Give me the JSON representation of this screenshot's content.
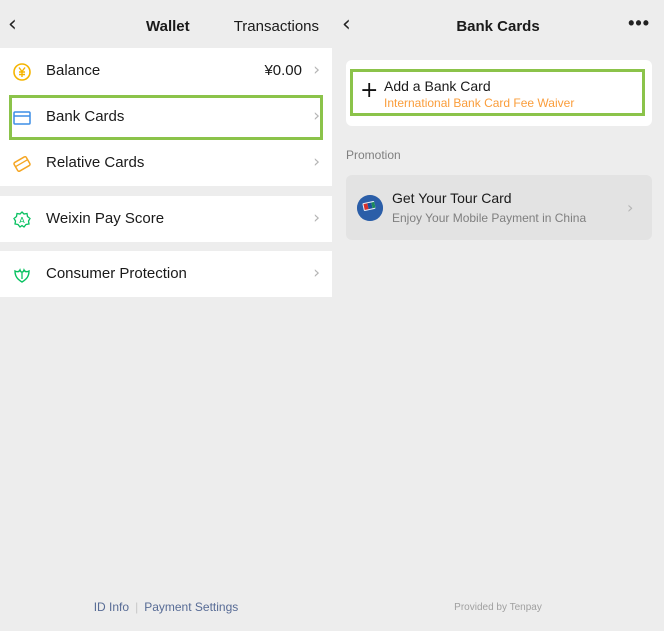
{
  "wallet": {
    "title": "Wallet",
    "transactions": "Transactions",
    "groups": [
      [
        {
          "label": "Balance",
          "value": "¥0.00",
          "icon": "yen-coin-icon"
        },
        {
          "label": "Bank Cards",
          "value": "",
          "icon": "card-icon"
        },
        {
          "label": "Relative Cards",
          "value": "",
          "icon": "relative-card-icon"
        }
      ],
      [
        {
          "label": "Weixin Pay Score",
          "value": "",
          "icon": "pay-score-icon"
        }
      ],
      [
        {
          "label": "Consumer Protection",
          "value": "",
          "icon": "protection-icon"
        }
      ]
    ],
    "footer": {
      "id_info": "ID Info",
      "payment_settings": "Payment Settings"
    }
  },
  "bank_cards": {
    "title": "Bank Cards",
    "add_card": {
      "title": "Add a Bank Card",
      "subtitle": "International Bank Card Fee Waiver"
    },
    "promotion_label": "Promotion",
    "promotion": {
      "title": "Get Your Tour Card",
      "subtitle": "Enjoy Your Mobile Payment in China"
    },
    "provided_by": "Provided by Tenpay"
  },
  "colors": {
    "highlight": "#8bc34a",
    "accent": "#fa9d3b",
    "link": "#576b95",
    "coin": "#f5b400",
    "green": "#07c160"
  }
}
